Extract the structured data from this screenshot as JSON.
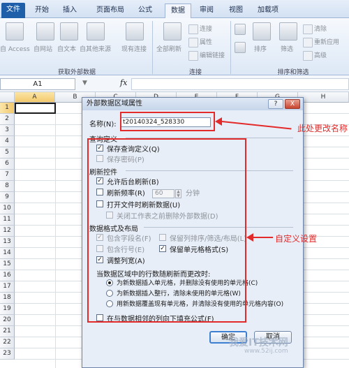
{
  "ribbon": {
    "tabs": [
      "文件",
      "开始",
      "插入",
      "页面布局",
      "公式",
      "数据",
      "审阅",
      "视图",
      "加载项"
    ],
    "active_tab": "数据",
    "buttons": {
      "access": "自 Access",
      "web": "自网站",
      "text": "自文本",
      "other": "自其他来源",
      "existing": "现有连接",
      "refresh_all": "全部刷新",
      "connections": "连接",
      "properties": "属性",
      "edit_links": "编辑链接",
      "sort": "排序",
      "filter": "筛选",
      "clear": "清除",
      "reapply": "重新应用",
      "advanced": "高级"
    },
    "groups": [
      "获取外部数据",
      "连接",
      "排序和筛选"
    ]
  },
  "formula_bar": {
    "name_box": "A1",
    "fx": "fx"
  },
  "sheet": {
    "columns": [
      "A",
      "B",
      "C",
      "D",
      "E",
      "F",
      "G",
      "H"
    ],
    "rows": [
      "1",
      "2",
      "3",
      "4",
      "5",
      "6",
      "7",
      "8",
      "9",
      "10",
      "11",
      "12",
      "13",
      "14",
      "15",
      "16",
      "17",
      "18",
      "19",
      "20",
      "21",
      "22",
      "23"
    ]
  },
  "dialog": {
    "title": "外部数据区域属性",
    "help": "?",
    "close": "X",
    "name_label": "名称(N):",
    "name_value": "t20140324_528330",
    "query_section": "查询定义",
    "save_query": "保存查询定义(Q)",
    "save_password": "保存密码(P)",
    "refresh_section": "刷新控件",
    "bg_refresh": "允许后台刷新(B)",
    "refresh_every": "刷新频率(R)",
    "refresh_value": "60",
    "minutes": "分钟",
    "refresh_on_open": "打开文件时刷新数据(U)",
    "remove_before_close": "关闭工作表之前删除外部数据(D)",
    "format_section": "数据格式及布局",
    "include_field_names": "包含字段名(F)",
    "preserve_sort": "保留列排序/筛选/布局(L)",
    "include_row_numbers": "包含行号(E)",
    "preserve_cell_format": "保留单元格格式(S)",
    "adjust_column_width": "调整列宽(A)",
    "rows_change_label": "当数据区域中的行数随刷新而更改时:",
    "opt_insert_cells": "为新数据插入单元格，并删除没有使用的单元格(C)",
    "opt_insert_rows": "为新数据插入整行，清除未使用的单元格(W)",
    "opt_overwrite": "用新数据覆盖现有单元格，并清除没有使用的单元格内容(O)",
    "fill_down": "在与数据相邻的列向下填充公式(F)",
    "ok": "确定",
    "cancel": "取消"
  },
  "annotations": {
    "rename_note": "此处更改名称",
    "custom_note": "自定义设置",
    "color": "#e32a2a"
  },
  "watermark": {
    "main": "我爱IT技术网",
    "url": "www.52ij.com"
  }
}
